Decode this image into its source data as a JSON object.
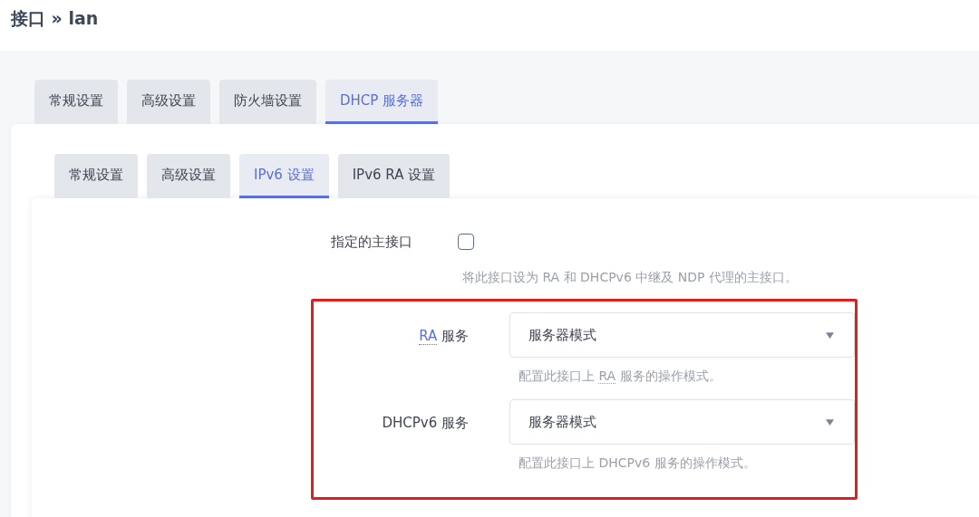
{
  "title": "接口 » lan",
  "tabs": [
    {
      "label": "常规设置",
      "selected": false
    },
    {
      "label": "高级设置",
      "selected": false
    },
    {
      "label": "防火墙设置",
      "selected": false
    },
    {
      "label": "DHCP 服务器",
      "selected": true
    }
  ],
  "subtabs": [
    {
      "label": "常规设置",
      "selected": false
    },
    {
      "label": "高级设置",
      "selected": false
    },
    {
      "label": "IPv6 设置",
      "selected": true
    },
    {
      "label": "IPv6 RA 设置",
      "selected": false
    }
  ],
  "fields": [
    {
      "kind": "checkbox",
      "label": [
        {
          "text": "指定的主接口"
        }
      ],
      "checked": false,
      "highlighted": false,
      "help": [
        {
          "text": "将此接口设为 RA 和 DHCPv6 中继及 NDP 代理的主接口。"
        }
      ]
    },
    {
      "kind": "select",
      "label": [
        {
          "text": "RA",
          "abbr": true
        },
        {
          "text": " 服务"
        }
      ],
      "value": "服务器模式",
      "highlighted": true,
      "help": [
        {
          "text": "配置此接口上 "
        },
        {
          "text": "RA",
          "abbr": true
        },
        {
          "text": " 服务的操作模式。"
        }
      ]
    },
    {
      "kind": "select",
      "label": [
        {
          "text": "DHCPv6 服务"
        }
      ],
      "value": "服务器模式",
      "highlighted": true,
      "help": [
        {
          "text": "配置此接口上 DHCPv6 服务的操作模式。"
        }
      ]
    }
  ]
}
